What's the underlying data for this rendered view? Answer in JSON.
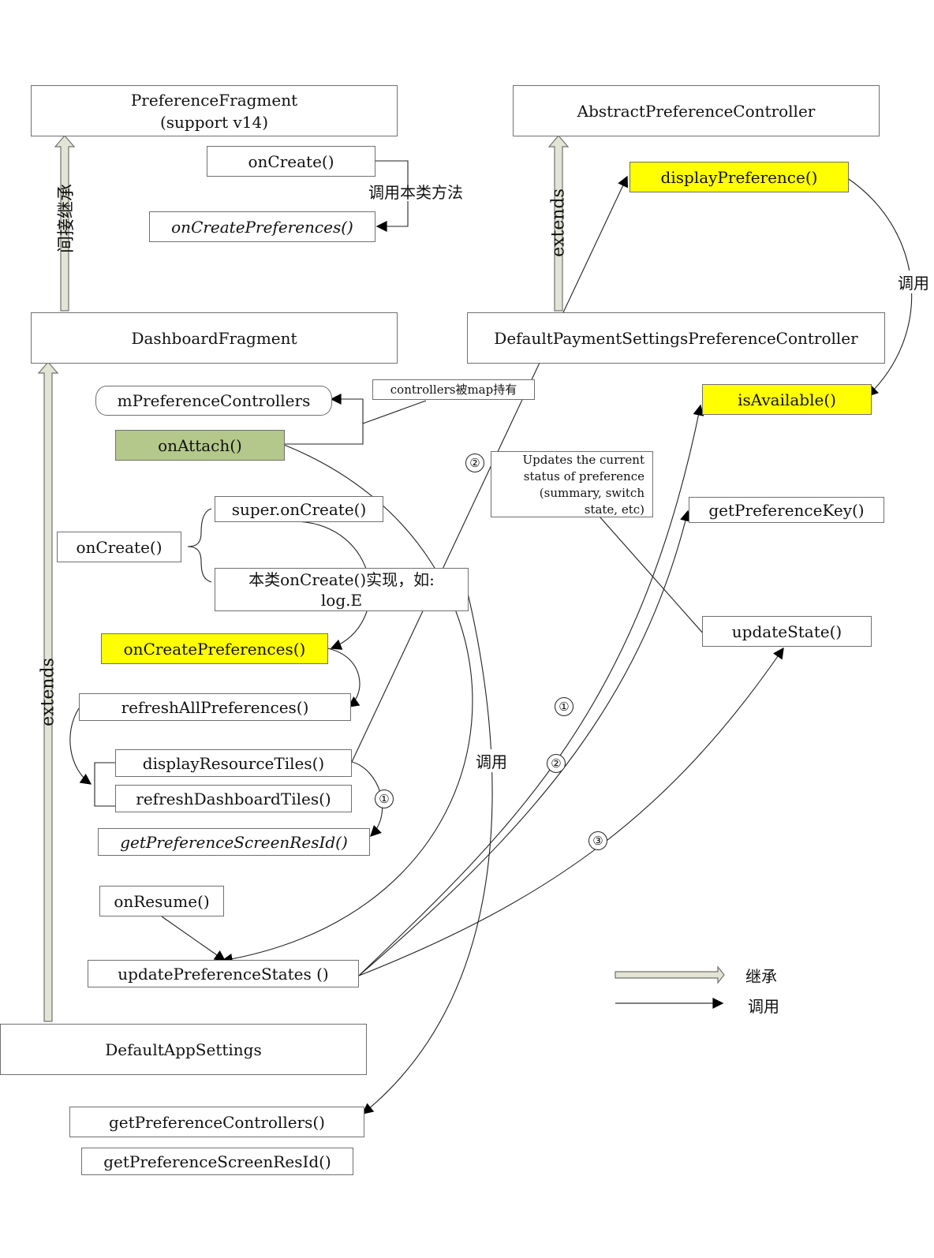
{
  "legend": {
    "inherit_label": "继承",
    "call_label": "调用"
  },
  "colors": {
    "highlight_yellow": "#ffff00",
    "highlight_green": "#b3c88a",
    "inherit_arrow_fill": "#e4e4d4",
    "border": "#707070"
  },
  "classes": {
    "preference_fragment": {
      "line1": "PreferenceFragment",
      "line2": "(support v14)"
    },
    "abstract_controller": "AbstractPreferenceController",
    "dashboard_fragment": "DashboardFragment",
    "default_payment_controller": "DefaultPaymentSettingsPreferenceController",
    "default_app_settings": "DefaultAppSettings"
  },
  "inherit_labels": {
    "indirect": "间接继承",
    "extends_right": "extends",
    "extends_left": "extends"
  },
  "preference_fragment_methods": {
    "on_create": "onCreate()",
    "call_self_label": "调用本类方法",
    "on_create_preferences": "onCreatePreferences()"
  },
  "controller_methods": {
    "display_preference": "displayPreference()",
    "call_label": "调用",
    "is_available": "isAvailable()",
    "get_preference_key": "getPreferenceKey()",
    "update_state": "updateState()",
    "update_state_note": "Updates the current\nstatus of preference\n(summary, switch\nstate, etc)"
  },
  "dashboard_methods": {
    "m_preference_controllers": "mPreferenceControllers",
    "map_note": "controllers被map持有",
    "on_attach": "onAttach()",
    "on_create": "onCreate()",
    "super_on_create": "super.onCreate()",
    "self_on_create_line1": "本类onCreate()实现，如:",
    "self_on_create_line2": "log.E",
    "on_create_preferences": "onCreatePreferences()",
    "refresh_all_preferences": "refreshAllPreferences()",
    "display_resource_tiles": "displayResourceTiles()",
    "refresh_dashboard_tiles": "refreshDashboardTiles()",
    "get_preference_screen_res_id": "getPreferenceScreenResId()",
    "on_resume": "onResume()",
    "update_preference_states": "updatePreferenceStates ()",
    "middle_call_label": "调用"
  },
  "app_settings_methods": {
    "get_preference_controllers": "getPreferenceControllers()",
    "get_preference_screen_res_id": "getPreferenceScreenResId()"
  },
  "step_markers": {
    "one": "①",
    "two": "②",
    "three": "③"
  }
}
